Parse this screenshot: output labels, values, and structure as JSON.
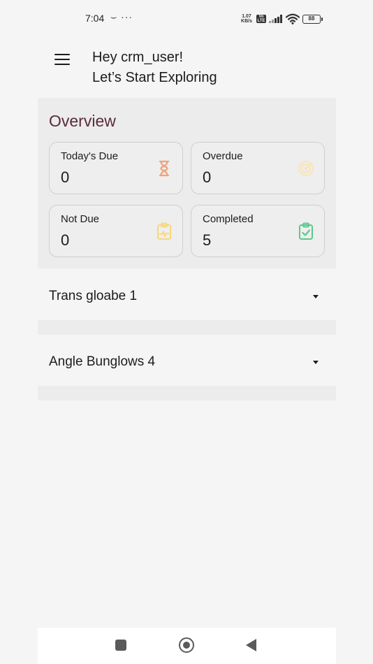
{
  "status_bar": {
    "time": "7:04",
    "extra": "⌣ ···",
    "net_speed_value": "1.07",
    "net_speed_unit": "KB/s",
    "volte": "Vo LTE",
    "battery": "88"
  },
  "header": {
    "greeting_line1": "Hey crm_user!",
    "greeting_line2": "Let’s Start Exploring"
  },
  "overview": {
    "title": "Overview",
    "cards": [
      {
        "label": "Today's Due",
        "value": "0",
        "icon": "hourglass-icon",
        "color": "#f0a27a"
      },
      {
        "label": "Overdue",
        "value": "0",
        "icon": "target-icon",
        "color": "#fbe3b8"
      },
      {
        "label": "Not Due",
        "value": "0",
        "icon": "clipboard-pulse-icon",
        "color": "#f8d774"
      },
      {
        "label": "Completed",
        "value": "5",
        "icon": "clipboard-check-icon",
        "color": "#5cc98a"
      }
    ]
  },
  "projects": [
    {
      "name": "Trans gloabe 1"
    },
    {
      "name": "Angle Bunglows 4"
    }
  ]
}
